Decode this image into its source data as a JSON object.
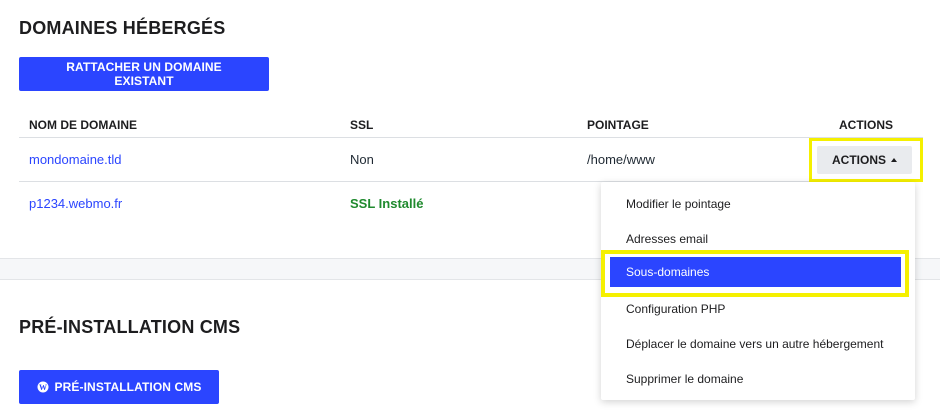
{
  "hosted_domains": {
    "title": "DOMAINES HÉBERGÉS",
    "attach_button": "RATTACHER UN DOMAINE EXISTANT",
    "columns": [
      "NOM DE DOMAINE",
      "SSL",
      "POINTAGE",
      "ACTIONS"
    ],
    "rows": [
      {
        "domain": "mondomaine.tld",
        "ssl": "Non",
        "pointage": "/home/www"
      },
      {
        "domain": "p1234.webmo.fr",
        "ssl": "SSL Installé",
        "pointage": ""
      }
    ],
    "actions_button": "ACTIONS",
    "actions_menu": [
      "Modifier le pointage",
      "Adresses email",
      "Sous-domaines",
      "Configuration PHP",
      "Déplacer le domaine vers un autre hébergement",
      "Supprimer le domaine"
    ]
  },
  "cms": {
    "title": "PRÉ-INSTALLATION CMS",
    "button": "PRÉ-INSTALLATION CMS",
    "button_icon": "wordpress-icon"
  },
  "colors": {
    "primary": "#2b45ff",
    "highlight": "#f5f000",
    "ssl_ok": "#1f8a2e"
  }
}
